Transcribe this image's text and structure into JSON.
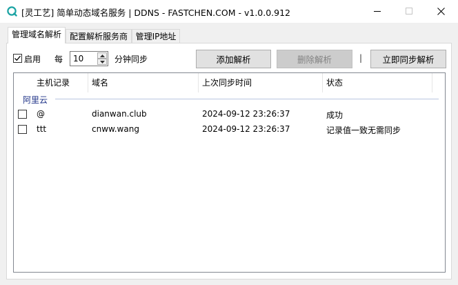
{
  "window": {
    "title": "[灵工艺] 简单动态域名服务 | DDNS - FASTCHEN.COM - v1.0.0.912",
    "icon": "app-logo-icon",
    "accent": "#1aa3a3"
  },
  "tabs": [
    {
      "label": "管理域名解析",
      "active": true
    },
    {
      "label": "配置解析服务商",
      "active": false
    },
    {
      "label": "管理IP地址",
      "active": false
    }
  ],
  "toolbar": {
    "enable_label": "启用",
    "enable_checked": true,
    "every_label": "每",
    "interval_value": "10",
    "interval_unit_label": "分钟同步",
    "add_label": "添加解析",
    "delete_label": "删除解析",
    "delete_disabled": true,
    "separator": "|",
    "sync_label": "立即同步解析"
  },
  "table": {
    "columns": [
      "主机记录",
      "域名",
      "上次同步时间",
      "状态"
    ],
    "group": "阿里云",
    "rows": [
      {
        "checked": false,
        "host": "@",
        "domain": "dianwan.club",
        "time": "2024-09-12 23:26:37",
        "status": "成功"
      },
      {
        "checked": false,
        "host": "ttt",
        "domain": "cnww.wang",
        "time": "2024-09-12 23:26:37",
        "status": "记录值一致无需同步"
      }
    ]
  }
}
